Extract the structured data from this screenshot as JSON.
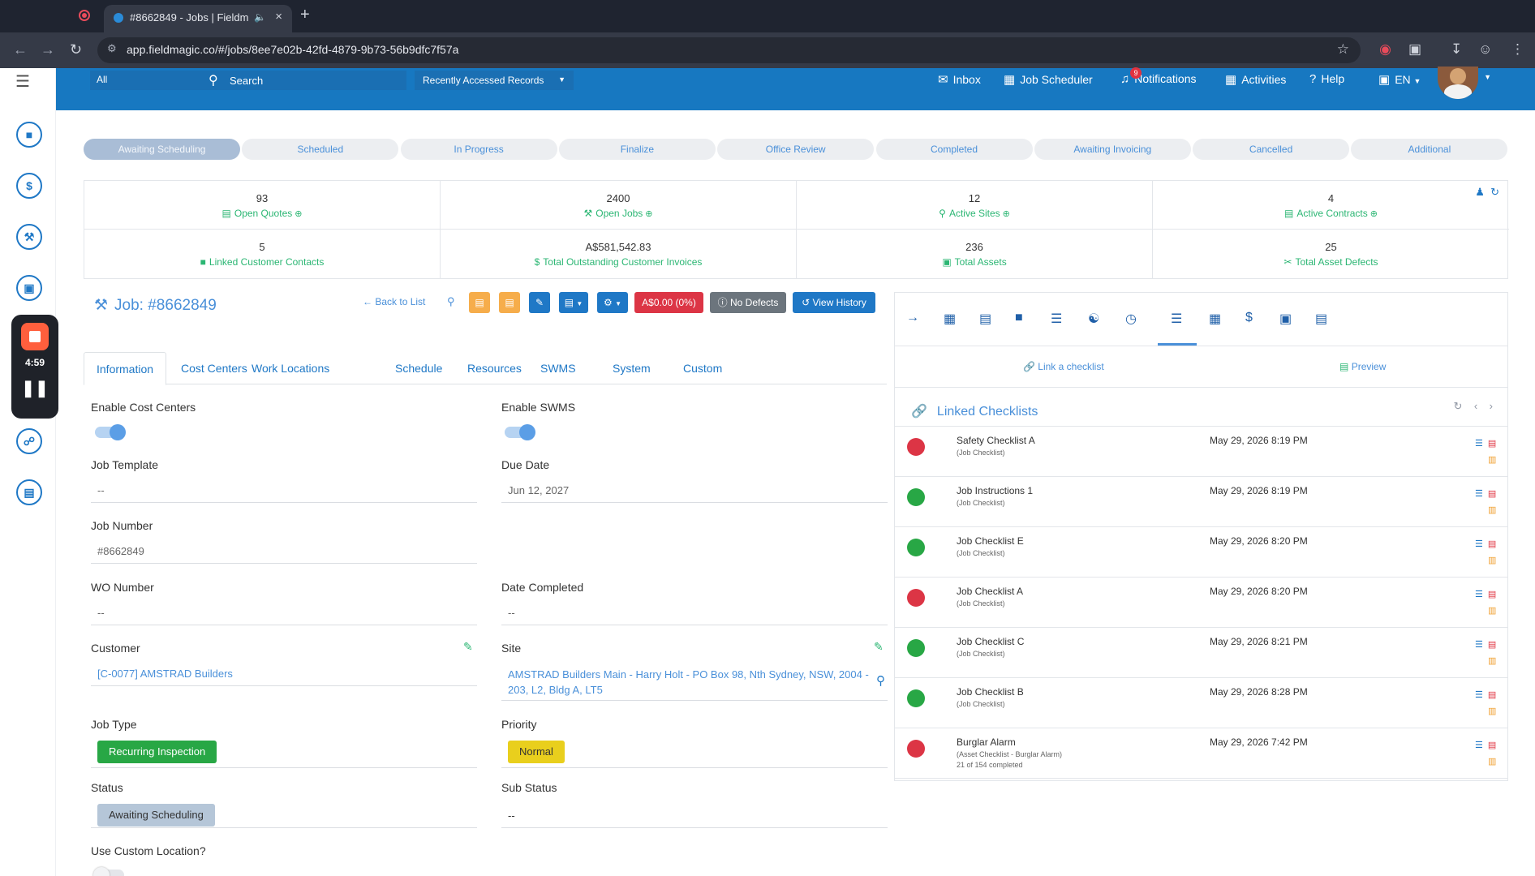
{
  "browser": {
    "tab_title": "#8662849 - Jobs | Fieldm",
    "url": "app.fieldmagic.co/#/jobs/8ee7e02b-42fd-4879-9b73-56b9dfc7f57a"
  },
  "header": {
    "scope_value": "All",
    "search_placeholder": "Search",
    "recent_label": "Recently Accessed Records",
    "nav": {
      "inbox": "Inbox",
      "scheduler": "Job Scheduler",
      "notifications": "Notifications",
      "notifications_count": "9",
      "activities": "Activities",
      "help": "Help",
      "language": "EN"
    },
    "brand_color": "#1778c1"
  },
  "recorder": {
    "time": "4:59"
  },
  "stages": [
    {
      "label": "Awaiting Scheduling",
      "active": true
    },
    {
      "label": "Scheduled",
      "active": false
    },
    {
      "label": "In Progress",
      "active": false
    },
    {
      "label": "Finalize",
      "active": false
    },
    {
      "label": "Office Review",
      "active": false
    },
    {
      "label": "Completed",
      "active": false
    },
    {
      "label": "Awaiting Invoicing",
      "active": false
    },
    {
      "label": "Cancelled",
      "active": false
    },
    {
      "label": "Additional",
      "active": false
    }
  ],
  "stats": [
    {
      "value": "93",
      "label": "Open Quotes",
      "icon": "quote-icon",
      "plus": true
    },
    {
      "value": "2400",
      "label": "Open Jobs",
      "icon": "wrench-icon",
      "plus": true
    },
    {
      "value": "12",
      "label": "Active Sites",
      "icon": "map-pin-icon",
      "plus": true
    },
    {
      "value": "4",
      "label": "Active Contracts",
      "icon": "contract-icon",
      "plus": true
    },
    {
      "value": "5",
      "label": "Linked Customer Contacts",
      "icon": "contact-icon",
      "plus": false
    },
    {
      "value": "A$581,542.83",
      "label": "Total Outstanding Customer Invoices",
      "icon": "dollar-icon",
      "plus": false
    },
    {
      "value": "236",
      "label": "Total Assets",
      "icon": "toolbox-icon",
      "plus": false
    },
    {
      "value": "25",
      "label": "Total Asset Defects",
      "icon": "unlink-icon",
      "plus": false
    }
  ],
  "job": {
    "title": "Job: #8662849",
    "back_label": "Back to List",
    "amount_label": "A$0.00 (0%)",
    "defects_label": "No Defects",
    "history_label": "View History"
  },
  "tabs": [
    "Information",
    "Cost Centers",
    "Work Locations",
    "Schedule",
    "Resources",
    "SWMS",
    "System",
    "Custom"
  ],
  "form": {
    "enable_cost_centers_label": "Enable Cost Centers",
    "enable_swms_label": "Enable SWMS",
    "job_template_label": "Job Template",
    "job_template_value": "--",
    "due_date_label": "Due Date",
    "due_date_value": "Jun 12, 2027",
    "job_number_label": "Job Number",
    "job_number_value": "#8662849",
    "wo_number_label": "WO Number",
    "wo_number_value": "--",
    "date_completed_label": "Date Completed",
    "date_completed_value": "--",
    "customer_label": "Customer",
    "customer_value": "[C-0077] AMSTRAD Builders",
    "site_label": "Site",
    "site_value_line1": "AMSTRAD Builders Main - Harry Holt - PO Box 98, Nth Sydney, NSW, 2004 -",
    "site_value_line2": "203, L2, Bldg A, LT5",
    "job_type_label": "Job Type",
    "job_type_value": "Recurring Inspection",
    "priority_label": "Priority",
    "priority_value": "Normal",
    "status_label": "Status",
    "status_value": "Awaiting Scheduling",
    "sub_status_label": "Sub Status",
    "sub_status_value": "--",
    "custom_location_label": "Use Custom Location?"
  },
  "panel": {
    "link_checklist_label": "Link a checklist",
    "preview_label": "Preview",
    "linked_title": "Linked Checklists",
    "checklists": [
      {
        "name": "Safety Checklist A",
        "type": "(Job Checklist)",
        "extra": "",
        "date": "May 29, 2026 8:19 PM",
        "status_color": "#dc3545"
      },
      {
        "name": "Job Instructions 1",
        "type": "(Job Checklist)",
        "extra": "",
        "date": "May 29, 2026 8:19 PM",
        "status_color": "#28a745"
      },
      {
        "name": "Job Checklist E",
        "type": "(Job Checklist)",
        "extra": "",
        "date": "May 29, 2026 8:20 PM",
        "status_color": "#28a745"
      },
      {
        "name": "Job Checklist A",
        "type": "(Job Checklist)",
        "extra": "",
        "date": "May 29, 2026 8:20 PM",
        "status_color": "#dc3545"
      },
      {
        "name": "Job Checklist C",
        "type": "(Job Checklist)",
        "extra": "",
        "date": "May 29, 2026 8:21 PM",
        "status_color": "#28a745"
      },
      {
        "name": "Job Checklist B",
        "type": "(Job Checklist)",
        "extra": "",
        "date": "May 29, 2026 8:28 PM",
        "status_color": "#28a745"
      },
      {
        "name": "Burglar Alarm",
        "type": "(Asset Checklist - Burglar Alarm)",
        "extra": "21 of 154 completed",
        "date": "May 29, 2026 7:42 PM",
        "status_color": "#dc3545"
      }
    ]
  }
}
